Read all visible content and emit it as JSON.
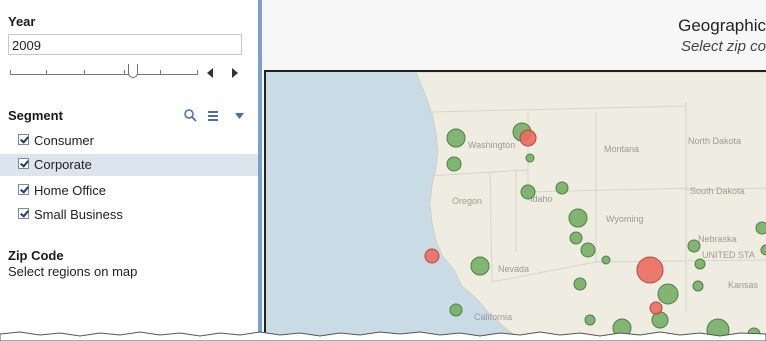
{
  "filters": {
    "year_label": "Year",
    "year_value": "2009",
    "segment_label": "Segment",
    "segment_items": [
      {
        "label": "Consumer",
        "checked": true
      },
      {
        "label": "Corporate",
        "checked": true,
        "highlighted": true
      },
      {
        "label": "Home Office",
        "checked": true
      },
      {
        "label": "Small Business",
        "checked": true
      }
    ],
    "zip_label": "Zip Code",
    "zip_description": "Select regions on map"
  },
  "map": {
    "title": "Geographic",
    "subtitle": "Select zip co",
    "state_labels": [
      "Washington",
      "Montana",
      "North Dakota",
      "Oregon",
      "Idaho",
      "South Dakota",
      "Wyoming",
      "Nebraska",
      "Nevada",
      "UNITED STA",
      "Kansas",
      "California"
    ],
    "colors": {
      "water": "#c9dbe5",
      "land": "#efece2",
      "green_bubble": "#6fac5d",
      "red_bubble": "#ea6d61"
    }
  },
  "icons": [
    "search-icon",
    "list-icon",
    "dropdown-icon",
    "prev-arrow-icon",
    "next-arrow-icon",
    "slider-thumb-icon"
  ]
}
